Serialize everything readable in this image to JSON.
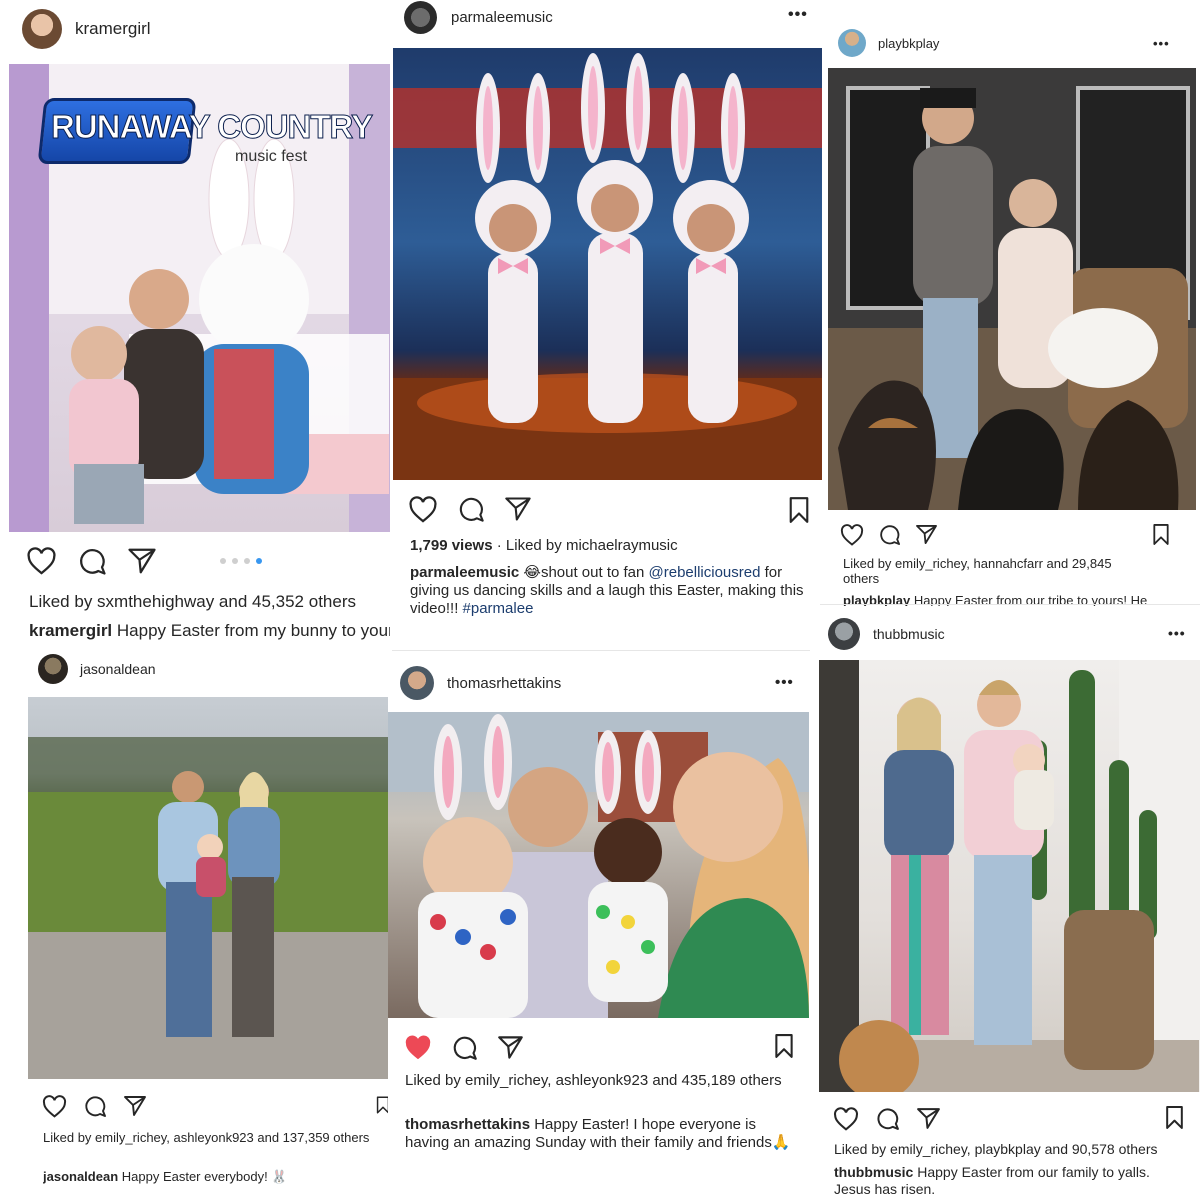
{
  "colors": {
    "like_active": "#ed4956",
    "link": "#1c3d6e",
    "dot_active": "#3897f0"
  },
  "posts": [
    {
      "username": "kramergirl",
      "photo_caption": "Easter bunny photo with woman and toddler",
      "logo_line1": "RUNAWAY COUNTRY",
      "logo_line2": "music fest",
      "likes_text": "Liked by sxmthehighway and 45,352 others",
      "caption_user": "kramergirl",
      "caption_text": " Happy Easter from my bunny to yours!",
      "carousel_total": 4,
      "carousel_active": 4
    },
    {
      "username": "parmaleemusic",
      "photo_caption": "Three dancing bunny animation",
      "views_text": "1,799 views",
      "liked_by_text": " · Liked by michaelraymusic",
      "caption_user": "parmaleemusic",
      "caption_emoji": "😂",
      "caption_text": "shout out to fan ",
      "caption_mention": "@rebelliciousred",
      "caption_text2": " for giving us dancing skills and a laugh this Easter, making this video!!! ",
      "caption_hashtag": "#parmalee"
    },
    {
      "username": "playbkplay",
      "photo_caption": "Couple with three dogs",
      "likes_text": "Liked by emily_richey, hannahcfarr and 29,845 others",
      "caption_user": "playbkplay",
      "caption_text": " Happy Easter from our tribe to yours! He"
    },
    {
      "username": "jasonaldean",
      "photo_caption": "Family standing on patio with baby",
      "likes_text": "Liked by emily_richey, ashleyonk923 and 137,359 others",
      "caption_user": "jasonaldean",
      "caption_text": " Happy Easter everybody! 🐰"
    },
    {
      "username": "thomasrhettakins",
      "photo_caption": "Family selfie with bunny ears",
      "likes_text": "Liked by emily_richey, ashleyonk923 and 435,189 others",
      "caption_user": "thomasrhettakins",
      "caption_text": " Happy Easter! I hope everyone is having an amazing Sunday with their family and friends🙏"
    },
    {
      "username": "thubbmusic",
      "photo_caption": "Couple holding baby on porch with cactus",
      "likes_text": "Liked by emily_richey, playbkplay and 90,578 others",
      "caption_user": "thubbmusic",
      "caption_text": " Happy Easter from our family to yalls. Jesus has risen."
    }
  ]
}
